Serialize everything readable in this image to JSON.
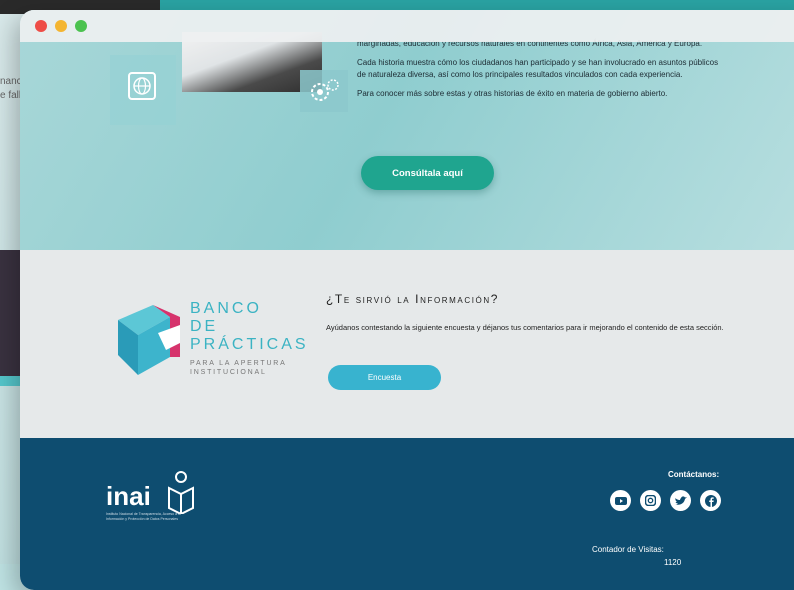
{
  "background": {
    "left_text": [
      "nanc",
      "e fall"
    ]
  },
  "hero": {
    "paragraphs": [
      "marginadas, educación y recursos naturales en continentes como África, Asia, América y Europa.",
      "Cada historia muestra cómo los ciudadanos han participado y se han involucrado en asuntos públicos de naturaleza diversa, así como los principales resultados vinculados con cada experiencia.",
      "Para conocer más sobre estas y otras historias de éxito en materia de gobierno abierto."
    ],
    "button_label": "Consúltala aquí"
  },
  "survey": {
    "logo_lines": [
      "BANCO",
      "DE",
      "PRÁCTICAS"
    ],
    "logo_sub_lines": [
      "PARA LA APERTURA",
      "INSTITUCIONAL"
    ],
    "title": "¿Te sirvió la Información?",
    "description": "Ayúdanos contestando la siguiente encuesta y déjanos tus comentarios para ir mejorando el contenido de esta sección.",
    "button_label": "Encuesta"
  },
  "footer": {
    "logo_word": "inai",
    "logo_subtitle": "Instituto Nacional de Transparencia, Acceso a la Información y Protección de Datos Personales",
    "contact_label": "Contáctanos:",
    "social": [
      "youtube-icon",
      "instagram-icon",
      "twitter-icon",
      "facebook-icon"
    ],
    "visits_label": "Contador de Visitas:",
    "visits_count": "1120"
  },
  "colors": {
    "consult_button": "#1fa58f",
    "survey_button": "#38b3cf",
    "footer_bg": "#0e4d70",
    "logo_teal": "#3bb3c3",
    "logo_pink": "#d6336c"
  }
}
